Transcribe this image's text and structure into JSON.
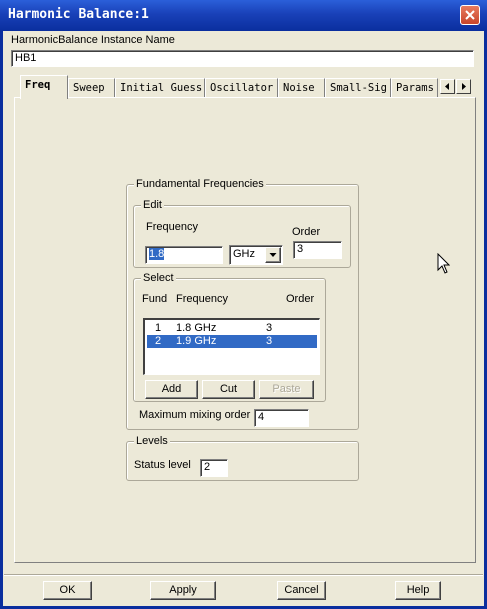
{
  "window": {
    "title": "Harmonic Balance:1"
  },
  "instance": {
    "label": "HarmonicBalance Instance Name",
    "value": "HB1"
  },
  "tabs": [
    "Freq",
    "Sweep",
    "Initial Guess",
    "Oscillator",
    "Noise",
    "Small-Sig",
    "Params"
  ],
  "active_tab": "Freq",
  "fundamental": {
    "group_title": "Fundamental Frequencies",
    "edit": {
      "group_title": "Edit",
      "frequency_label": "Frequency",
      "frequency_value": "1.8",
      "unit_value": "GHz",
      "order_label": "Order",
      "order_value": "3"
    },
    "select": {
      "group_title": "Select",
      "col_fund": "Fund",
      "col_frequency": "Frequency",
      "col_order": "Order",
      "rows": [
        {
          "fund": "1",
          "frequency": "1.8 GHz",
          "order": "3",
          "selected": false
        },
        {
          "fund": "2",
          "frequency": "1.9 GHz",
          "order": "3",
          "selected": true
        }
      ],
      "add_label": "Add",
      "cut_label": "Cut",
      "paste_label": "Paste"
    },
    "max_mixing_label": "Maximum mixing order",
    "max_mixing_value": "4"
  },
  "levels": {
    "group_title": "Levels",
    "status_label": "Status level",
    "status_value": "2"
  },
  "footer": {
    "ok_label": "OK",
    "apply_label": "Apply",
    "cancel_label": "Cancel",
    "help_label": "Help"
  },
  "icons": {
    "close": "close-icon",
    "dropdown": "chevron-down-icon",
    "tab_left": "arrow-left-icon",
    "tab_right": "arrow-right-icon",
    "cursor": "mouse-cursor-icon"
  },
  "colors": {
    "title_bar": "#0a2e9e",
    "selection": "#316ac5",
    "dialog_bg": "#ece9d8"
  }
}
